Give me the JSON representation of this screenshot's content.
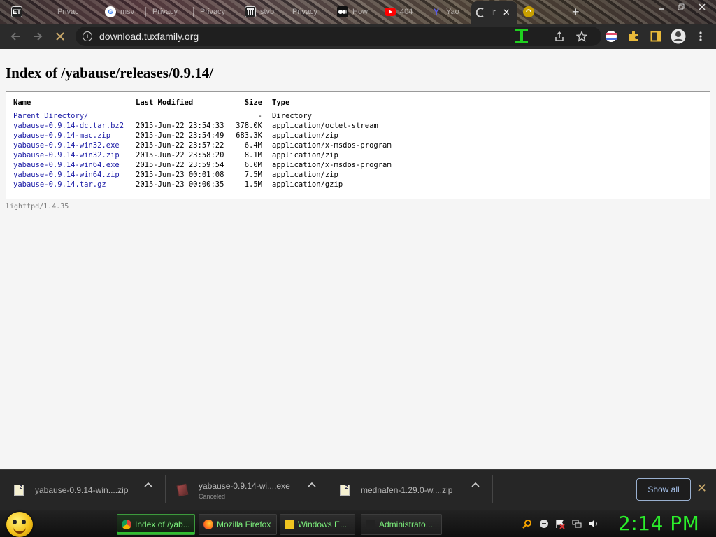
{
  "browser": {
    "tabs": [
      {
        "label": "ET",
        "title": "",
        "fav_color": "#222222"
      },
      {
        "label": "",
        "title": "Privac",
        "fav_color": ""
      },
      {
        "label": "G",
        "title": "msv",
        "fav_color": "#ffffff"
      },
      {
        "label": "",
        "title": "Privacy",
        "fav_color": ""
      },
      {
        "label": "",
        "title": "Privacy",
        "fav_color": ""
      },
      {
        "label": "",
        "title": "stvb",
        "fav_color": "#222222"
      },
      {
        "label": "",
        "title": "Privacy",
        "fav_color": ""
      },
      {
        "label": "",
        "title": "How",
        "fav_color": "#111111"
      },
      {
        "label": "",
        "title": "404",
        "fav_color": "#ff0000"
      },
      {
        "label": "Y",
        "title": "Yao",
        "fav_color": "#3b3bd1"
      },
      {
        "label": "",
        "title": "Ir",
        "fav_color": ""
      },
      {
        "label": "",
        "title": "",
        "fav_color": "#c9a000"
      }
    ],
    "active_tab_title": "Ir",
    "new_tab_label": "+",
    "url": "download.tuxfamily.org"
  },
  "page": {
    "heading": "Index of /yabause/releases/0.9.14/",
    "columns": [
      "Name",
      "Last Modified",
      "Size",
      "Type"
    ],
    "rows": [
      {
        "name": "Parent Directory/",
        "modified": "",
        "size": "-",
        "type": "Directory"
      },
      {
        "name": "yabause-0.9.14-dc.tar.bz2",
        "modified": "2015-Jun-22 23:54:33",
        "size": "378.0K",
        "type": "application/octet-stream"
      },
      {
        "name": "yabause-0.9.14-mac.zip",
        "modified": "2015-Jun-22 23:54:49",
        "size": "683.3K",
        "type": "application/zip"
      },
      {
        "name": "yabause-0.9.14-win32.exe",
        "modified": "2015-Jun-22 23:57:22",
        "size": "6.4M",
        "type": "application/x-msdos-program"
      },
      {
        "name": "yabause-0.9.14-win32.zip",
        "modified": "2015-Jun-22 23:58:20",
        "size": "8.1M",
        "type": "application/zip"
      },
      {
        "name": "yabause-0.9.14-win64.exe",
        "modified": "2015-Jun-22 23:59:54",
        "size": "6.0M",
        "type": "application/x-msdos-program"
      },
      {
        "name": "yabause-0.9.14-win64.zip",
        "modified": "2015-Jun-23 00:01:08",
        "size": "7.5M",
        "type": "application/zip"
      },
      {
        "name": "yabause-0.9.14.tar.gz",
        "modified": "2015-Jun-23 00:00:35",
        "size": "1.5M",
        "type": "application/gzip"
      }
    ],
    "server": "lighttpd/1.4.35"
  },
  "downloads": {
    "items": [
      {
        "name": "yabause-0.9.14-win....zip",
        "status": ""
      },
      {
        "name": "yabause-0.9.14-wi....exe",
        "status": "Canceled"
      },
      {
        "name": "mednafen-1.29.0-w....zip",
        "status": ""
      }
    ],
    "show_all": "Show all",
    "close": "✕"
  },
  "taskbar": {
    "tasks": [
      {
        "label": "Index of /yab...",
        "icon_color": "#dd4b39",
        "active": true
      },
      {
        "label": "Mozilla Firefox",
        "icon_color": "#ff7a1a",
        "active": false
      },
      {
        "label": "Windows E...",
        "icon_color": "#f0c420",
        "active": false
      },
      {
        "label": "Administrato...",
        "icon_color": "#444444",
        "active": false
      }
    ],
    "clock": "2:14 PM"
  },
  "colors": {
    "link": "#1a1aa6",
    "clock": "#2bf02b",
    "task_text": "#7cf07c"
  }
}
